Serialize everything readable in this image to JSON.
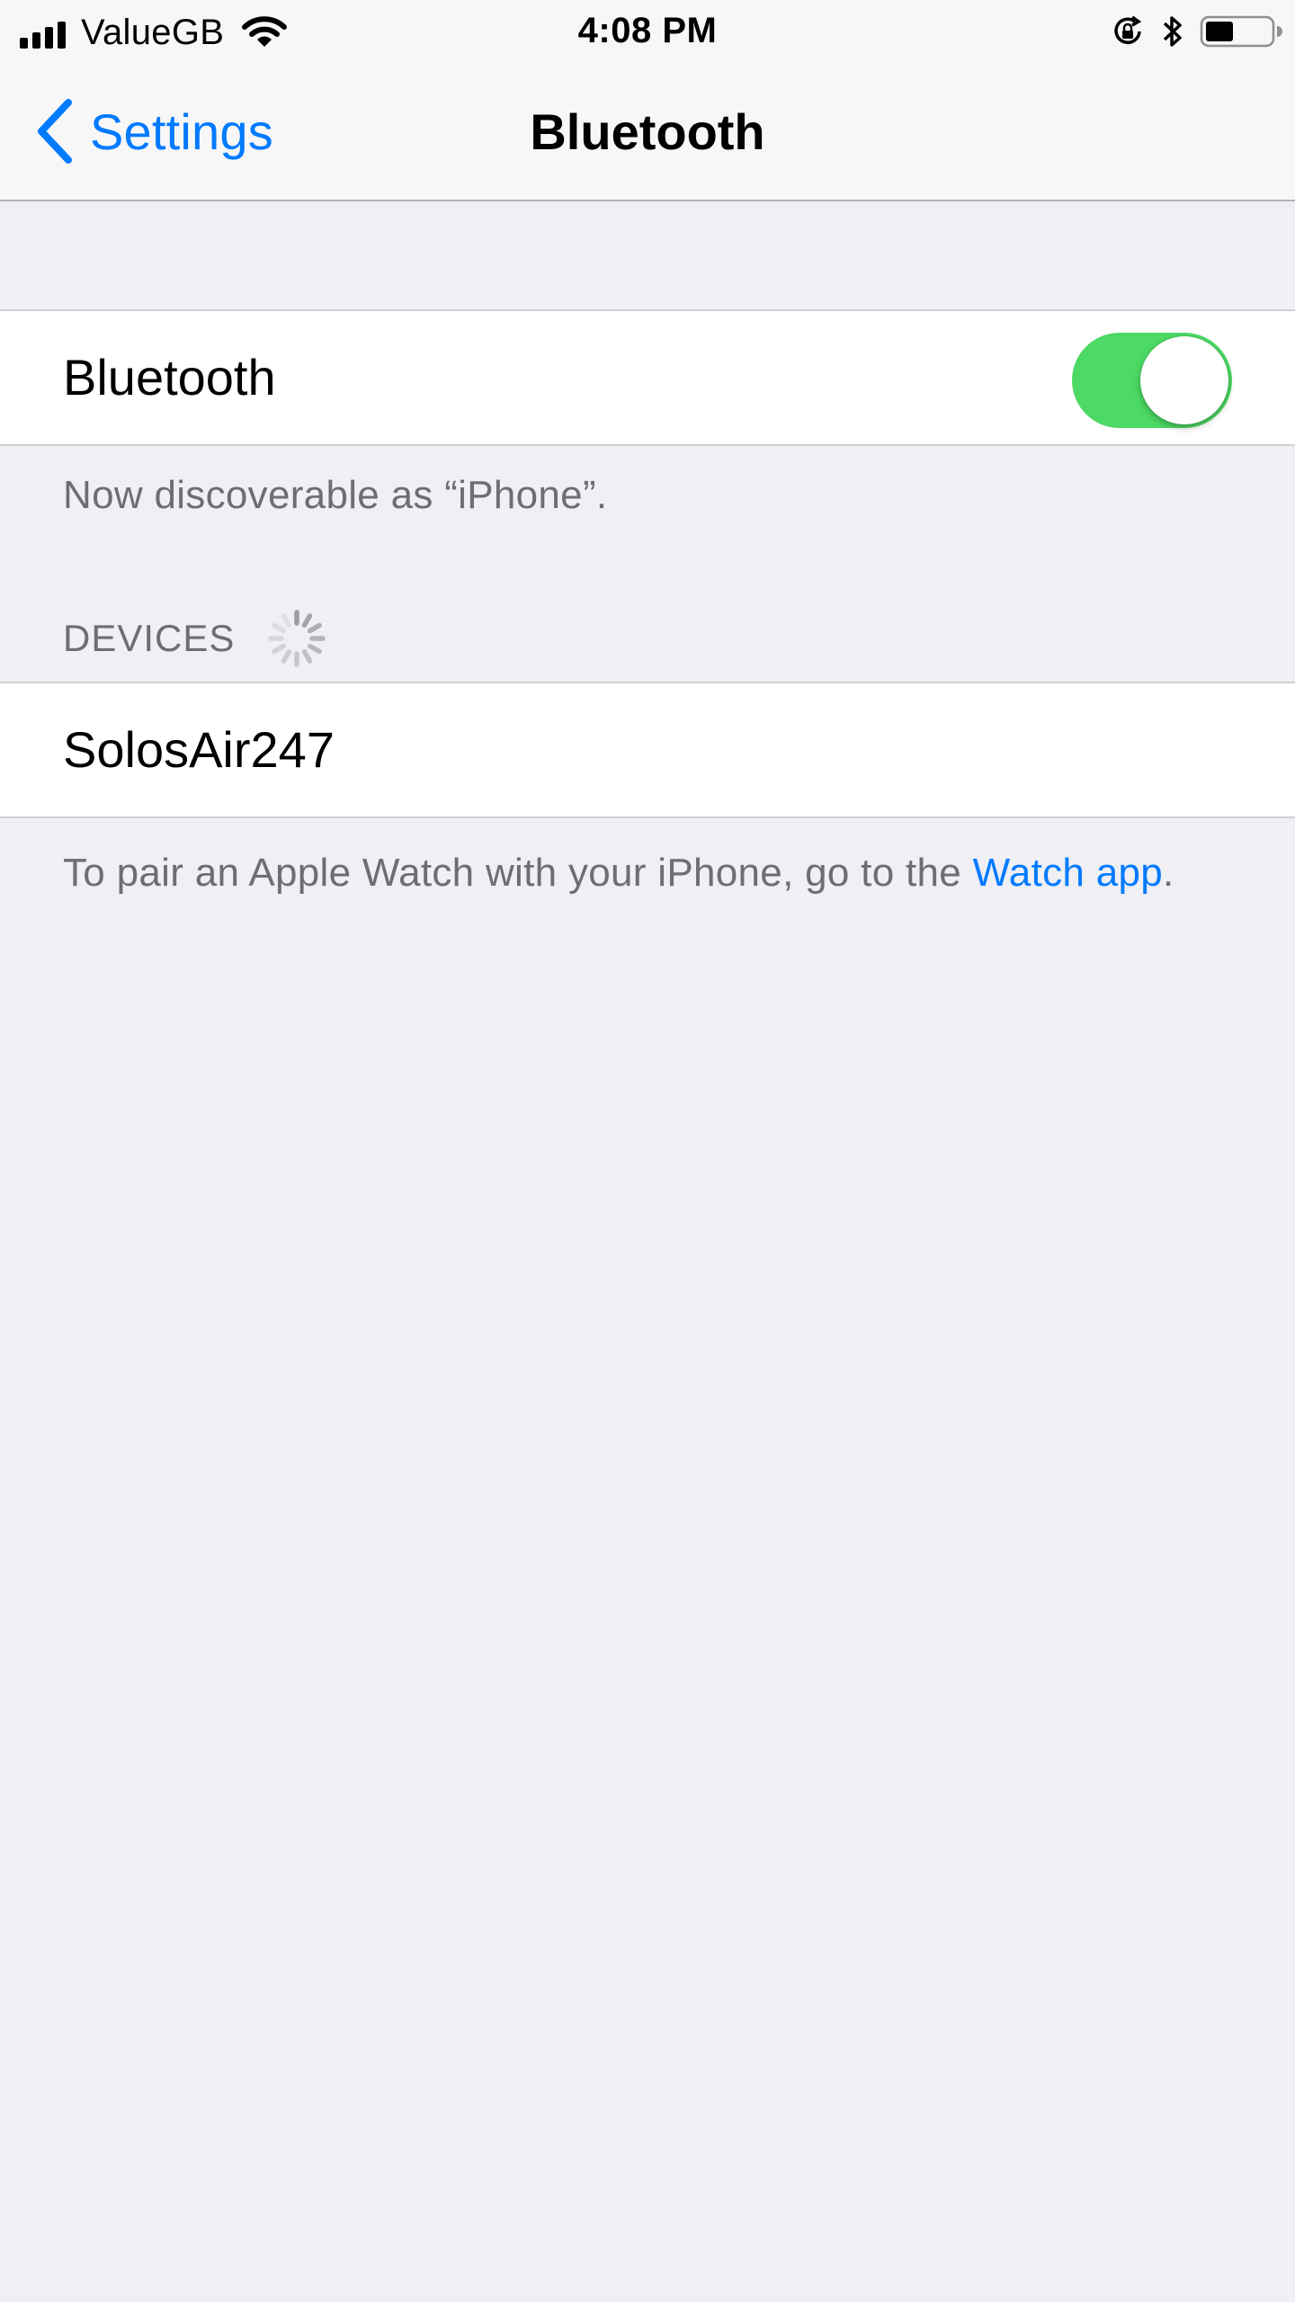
{
  "status_bar": {
    "carrier": "ValueGB",
    "time": "4:08 PM",
    "icons": [
      "signal-icon",
      "wifi-icon",
      "orientation-lock-icon",
      "bluetooth-icon",
      "battery-icon"
    ],
    "battery_level": 0.4
  },
  "nav": {
    "back_label": "Settings",
    "title": "Bluetooth"
  },
  "bluetooth_cell": {
    "label": "Bluetooth",
    "toggle_on": true
  },
  "discoverable_text": "Now discoverable as “iPhone”.",
  "devices": {
    "header": "DEVICES",
    "items": [
      {
        "name": "SolosAir247"
      }
    ]
  },
  "footer": {
    "text": "To pair an Apple Watch with your iPhone, go to the ",
    "link": "Watch app",
    "suffix": "."
  },
  "colors": {
    "accent": "#007aff",
    "toggle_on": "#4cd964",
    "background": "#efeff4",
    "secondary_text": "#6d6d72"
  }
}
